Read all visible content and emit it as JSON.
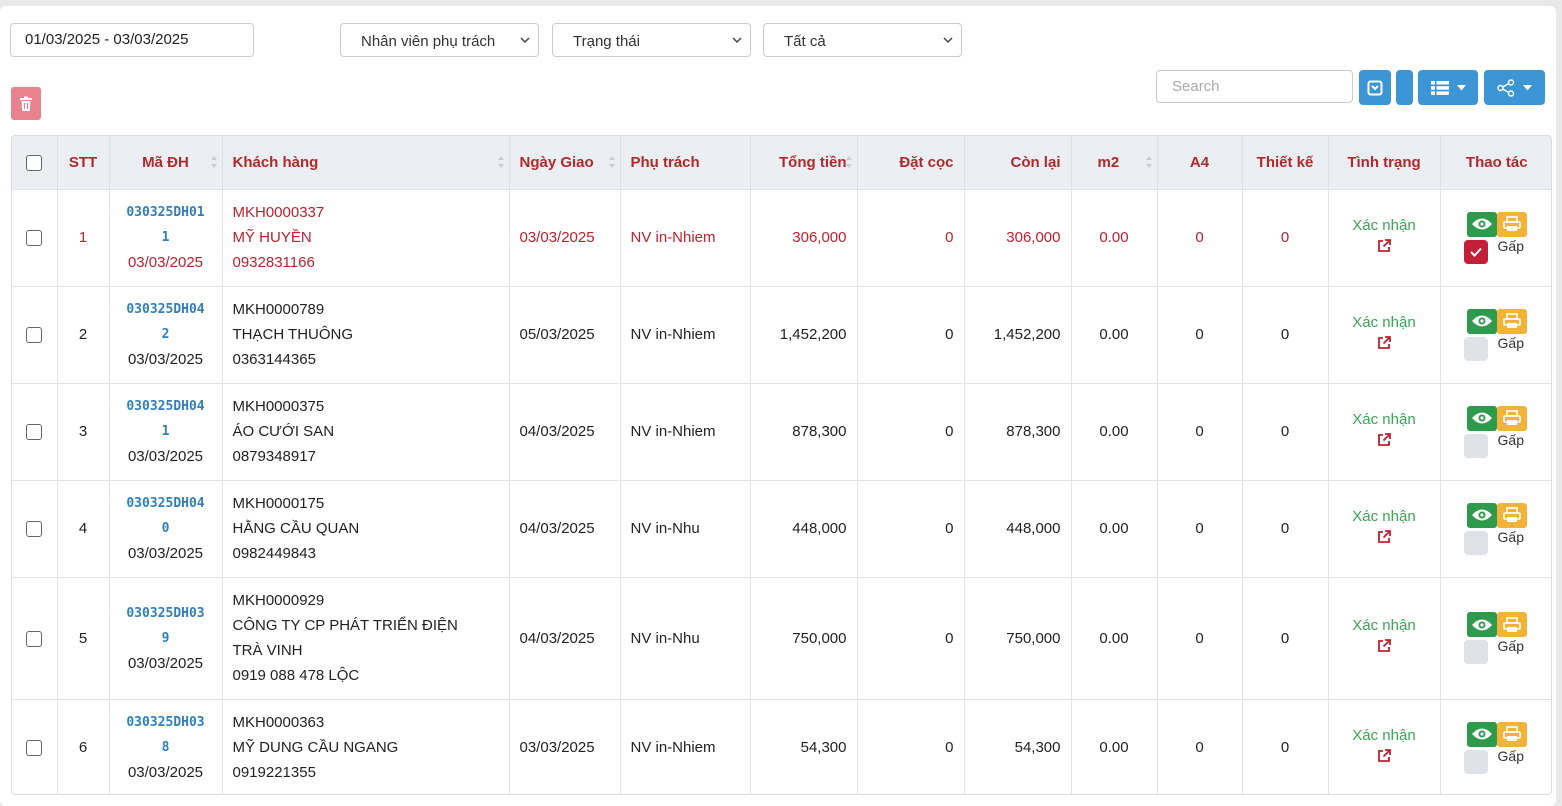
{
  "filters": {
    "date_range": "01/03/2025 - 03/03/2025",
    "staff_select": "Nhân viên phụ trách",
    "status_select": "Trạng thái",
    "all_select": "Tất cả"
  },
  "toolbar": {
    "search_placeholder": "Search"
  },
  "colors": {
    "header_text": "#b02a2a",
    "highlight": "#c0202e",
    "code_link": "#2f7fbf",
    "status_green": "#3aa655",
    "button_blue": "#3c96d6",
    "delete_pink": "#e8828f",
    "view_green": "#2e9a4b",
    "print_yellow": "#f3b339"
  },
  "table": {
    "headers": {
      "stt": "STT",
      "code": "Mã ĐH",
      "customer": "Khách hàng",
      "delivery": "Ngày Giao",
      "staff": "Phụ trách",
      "total": "Tổng tiền",
      "deposit": "Đặt cọc",
      "remaining": "Còn lại",
      "m2": "m2",
      "a4": "A4",
      "design": "Thiết kế",
      "status": "Tình trạng",
      "action": "Thao tác"
    },
    "rows": [
      {
        "stt": "1",
        "code_a": "030325DH01",
        "code_b": "1",
        "date": "03/03/2025",
        "cust_id": "MKH0000337",
        "cust_name": "MỸ HUYỀN",
        "cust_name2": "",
        "cust_phone": "0932831166",
        "delivery": "03/03/2025",
        "staff": "NV in-Nhiem",
        "total": "306,000",
        "deposit": "0",
        "remaining": "306,000",
        "m2": "0.00",
        "a4": "0",
        "design": "0",
        "status": "Xác nhận",
        "urgent_label": "Gấp",
        "urgent": true
      },
      {
        "stt": "2",
        "code_a": "030325DH04",
        "code_b": "2",
        "date": "03/03/2025",
        "cust_id": "MKH0000789",
        "cust_name": "THẠCH THUÔNG",
        "cust_name2": "",
        "cust_phone": "0363144365",
        "delivery": "05/03/2025",
        "staff": "NV in-Nhiem",
        "total": "1,452,200",
        "deposit": "0",
        "remaining": "1,452,200",
        "m2": "0.00",
        "a4": "0",
        "design": "0",
        "status": "Xác nhận",
        "urgent_label": "Gấp",
        "urgent": false
      },
      {
        "stt": "3",
        "code_a": "030325DH04",
        "code_b": "1",
        "date": "03/03/2025",
        "cust_id": "MKH0000375",
        "cust_name": "ÁO CƯỚI SAN",
        "cust_name2": "",
        "cust_phone": "0879348917",
        "delivery": "04/03/2025",
        "staff": "NV in-Nhiem",
        "total": "878,300",
        "deposit": "0",
        "remaining": "878,300",
        "m2": "0.00",
        "a4": "0",
        "design": "0",
        "status": "Xác nhận",
        "urgent_label": "Gấp",
        "urgent": false
      },
      {
        "stt": "4",
        "code_a": "030325DH04",
        "code_b": "0",
        "date": "03/03/2025",
        "cust_id": "MKH0000175",
        "cust_name": "HẰNG CẦU QUAN",
        "cust_name2": "",
        "cust_phone": "0982449843",
        "delivery": "04/03/2025",
        "staff": "NV in-Nhu",
        "total": "448,000",
        "deposit": "0",
        "remaining": "448,000",
        "m2": "0.00",
        "a4": "0",
        "design": "0",
        "status": "Xác nhận",
        "urgent_label": "Gấp",
        "urgent": false
      },
      {
        "stt": "5",
        "code_a": "030325DH03",
        "code_b": "9",
        "date": "03/03/2025",
        "cust_id": "MKH0000929",
        "cust_name": "CÔNG TY CP PHÁT TRIỂN ĐIỆN",
        "cust_name2": "TRÀ VINH",
        "cust_phone": "0919 088 478 LỘC",
        "delivery": "04/03/2025",
        "staff": "NV in-Nhu",
        "total": "750,000",
        "deposit": "0",
        "remaining": "750,000",
        "m2": "0.00",
        "a4": "0",
        "design": "0",
        "status": "Xác nhận",
        "urgent_label": "Gấp",
        "urgent": false
      },
      {
        "stt": "6",
        "code_a": "030325DH03",
        "code_b": "8",
        "date": "03/03/2025",
        "cust_id": "MKH0000363",
        "cust_name": "MỸ DUNG CẦU NGANG",
        "cust_name2": "",
        "cust_phone": "0919221355",
        "delivery": "03/03/2025",
        "staff": "NV in-Nhiem",
        "total": "54,300",
        "deposit": "0",
        "remaining": "54,300",
        "m2": "0.00",
        "a4": "0",
        "design": "0",
        "status": "Xác nhận",
        "urgent_label": "Gấp",
        "urgent": false
      }
    ]
  }
}
